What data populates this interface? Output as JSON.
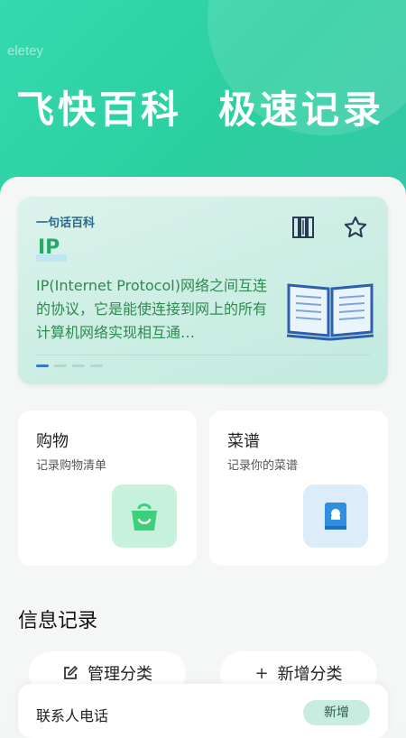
{
  "header": {
    "watermark": "eletey",
    "slogan_left": "飞快百科",
    "slogan_right": "极速记录"
  },
  "encyclopedia_card": {
    "kicker": "一句话百科",
    "term": "IP",
    "description": "IP(Internet Protocol)网络之间互连的协议，它是能使连接到网上的所有计算机网络实现相互通…",
    "icons": [
      "books-icon",
      "star-icon",
      "open-book-illustration"
    ],
    "page_count": 4,
    "active_page": 1
  },
  "tiles": [
    {
      "title": "购物",
      "subtitle": "记录购物清单",
      "icon": "shopping-bag-icon",
      "icon_bg": "#c6f1da",
      "icon_color": "#3ccf7c"
    },
    {
      "title": "菜谱",
      "subtitle": "记录你的菜谱",
      "icon": "recipe-book-icon",
      "icon_bg": "#dcecf9",
      "icon_color": "#2f8ee0"
    }
  ],
  "records": {
    "section_title": "信息记录",
    "manage_label": "管理分类",
    "add_category_label": "新增分类",
    "contact_label": "联系人电话",
    "contact_add_label": "新增"
  },
  "colors": {
    "brand_green": "#2ccf9f",
    "term_green": "#26a869",
    "accent_blue": "#3a78c4"
  }
}
